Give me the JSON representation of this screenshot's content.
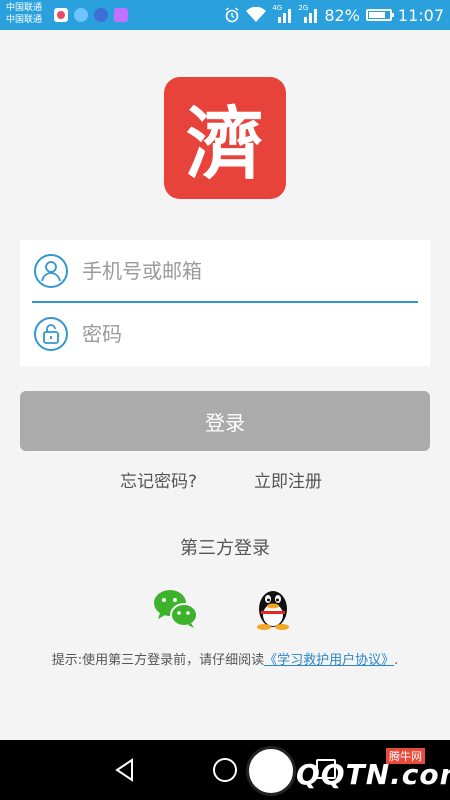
{
  "status_bar": {
    "carrier_1": "中国联通",
    "carrier_2": "中国联通",
    "network_1": "4G",
    "network_2": "2G",
    "battery": "82%",
    "battery_level": 0.82,
    "time": "11:07"
  },
  "logo": {
    "char": "濟",
    "color": "#e8433b"
  },
  "form": {
    "phone_placeholder": "手机号或邮箱",
    "password_placeholder": "密码",
    "accent_color": "#3196d1"
  },
  "login_button": {
    "label": "登录",
    "color": "#ababab"
  },
  "links": {
    "forgot": "忘记密码?",
    "register": "立即注册"
  },
  "third_party": {
    "title": "第三方登录",
    "wechat_icon": "wechat-icon",
    "qq_icon": "qq-icon"
  },
  "agreement": {
    "prefix": "提示:使用第三方登录前，请仔细阅读",
    "link": "《学习救护用户协议》",
    "suffix": "."
  },
  "watermark": {
    "text": "QQTN.com",
    "tag": "腾牛网"
  }
}
